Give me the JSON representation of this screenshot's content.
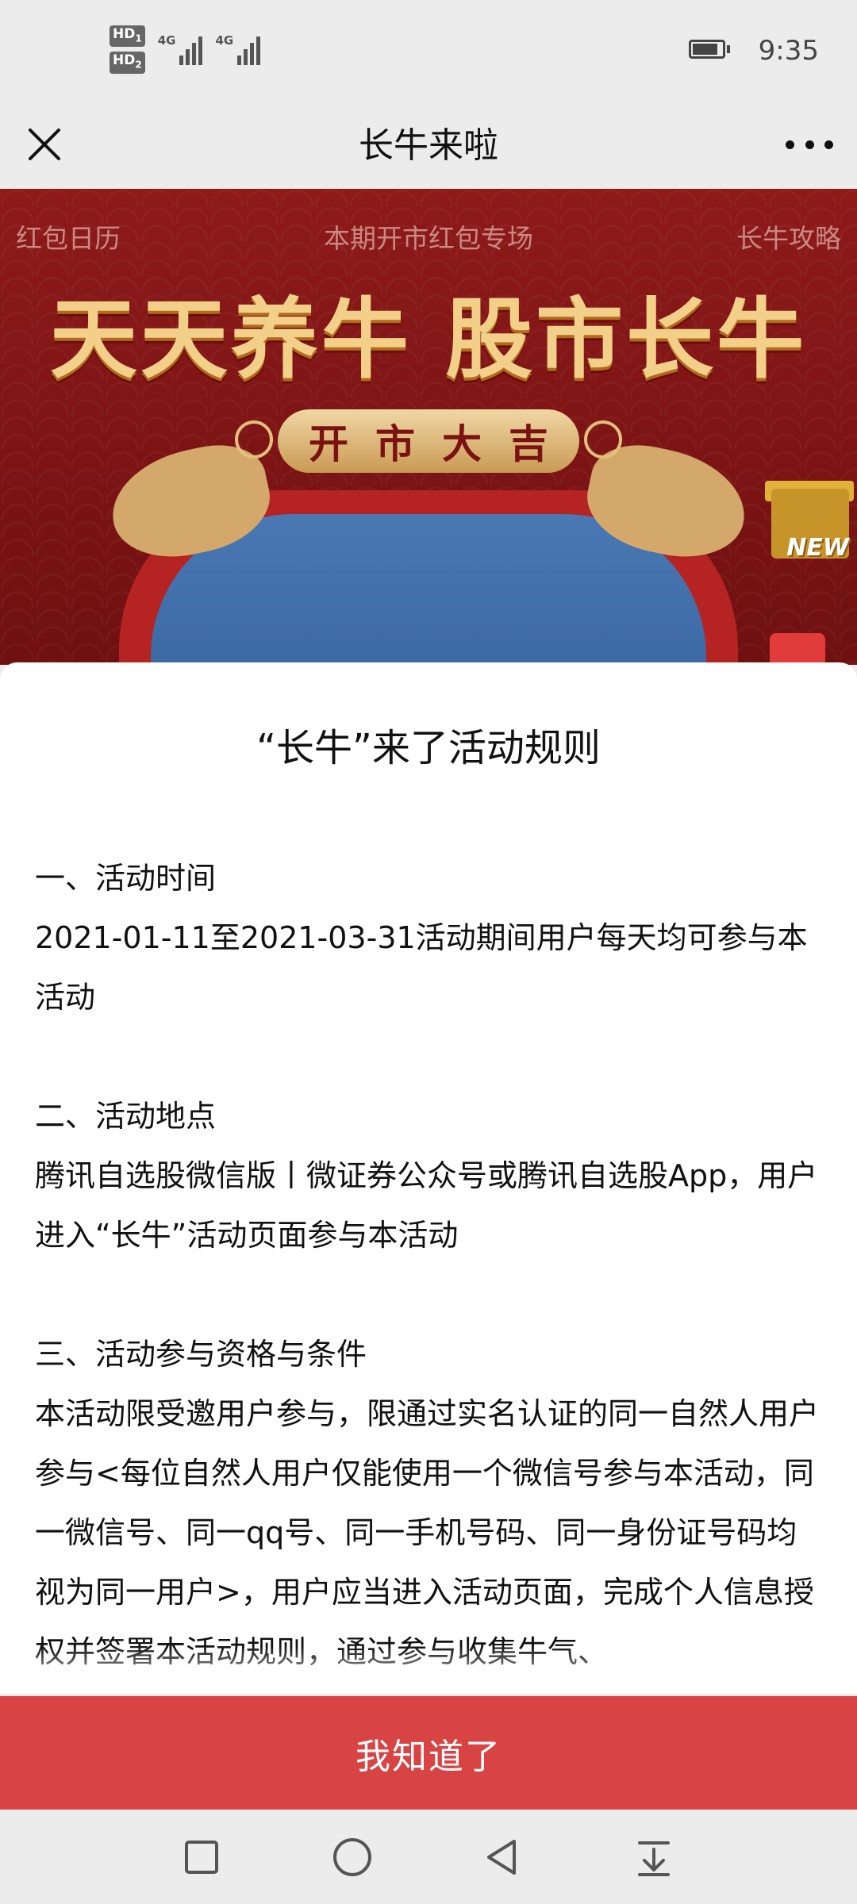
{
  "status_bar": {
    "sim1_label": "HD",
    "sim1_index": "1",
    "sim2_label": "HD",
    "sim2_index": "2",
    "network1": "4G",
    "network2": "4G",
    "time": "9:35",
    "battery_level": 0.85
  },
  "title_bar": {
    "title": "长牛来啦",
    "close_icon": "close-icon",
    "more_icon": "more-icon"
  },
  "banner": {
    "nav_left": "红包日历",
    "nav_center": "本期开市红包专场",
    "nav_right": "长牛攻略",
    "headline": "天天养牛 股市长牛",
    "ribbon_chars": [
      "开",
      "市",
      "大",
      "吉"
    ],
    "gift_tag": "NEW"
  },
  "modal": {
    "title": "“长牛”来了活动规则",
    "sections": [
      {
        "heading": "一、活动时间",
        "body": "2021-01-11至2021-03-31活动期间用户每天均可参与本活动"
      },
      {
        "heading": "二、活动地点",
        "body": "腾讯自选股微信版丨微证券公众号或腾讯自选股App，用户进入“长牛”活动页面参与本活动"
      },
      {
        "heading": "三、活动参与资格与条件",
        "body": "本活动限受邀用户参与，限通过实名认证的同一自然人用户参与<每位自然人用户仅能使用一个微信号参与本活动，同一微信号、同一qq号、同一手机号码、同一身份证号码均视为同一用户>，用户应当进入活动页面，完成个人信息授权并签署本活动规则，通过参与收集牛气、"
      }
    ]
  },
  "confirm_button": {
    "label": "我知道了",
    "color": "#d84444"
  },
  "nav_bar": {
    "icons": [
      "recent-apps-icon",
      "home-icon",
      "back-icon",
      "notification-pull-icon"
    ]
  }
}
